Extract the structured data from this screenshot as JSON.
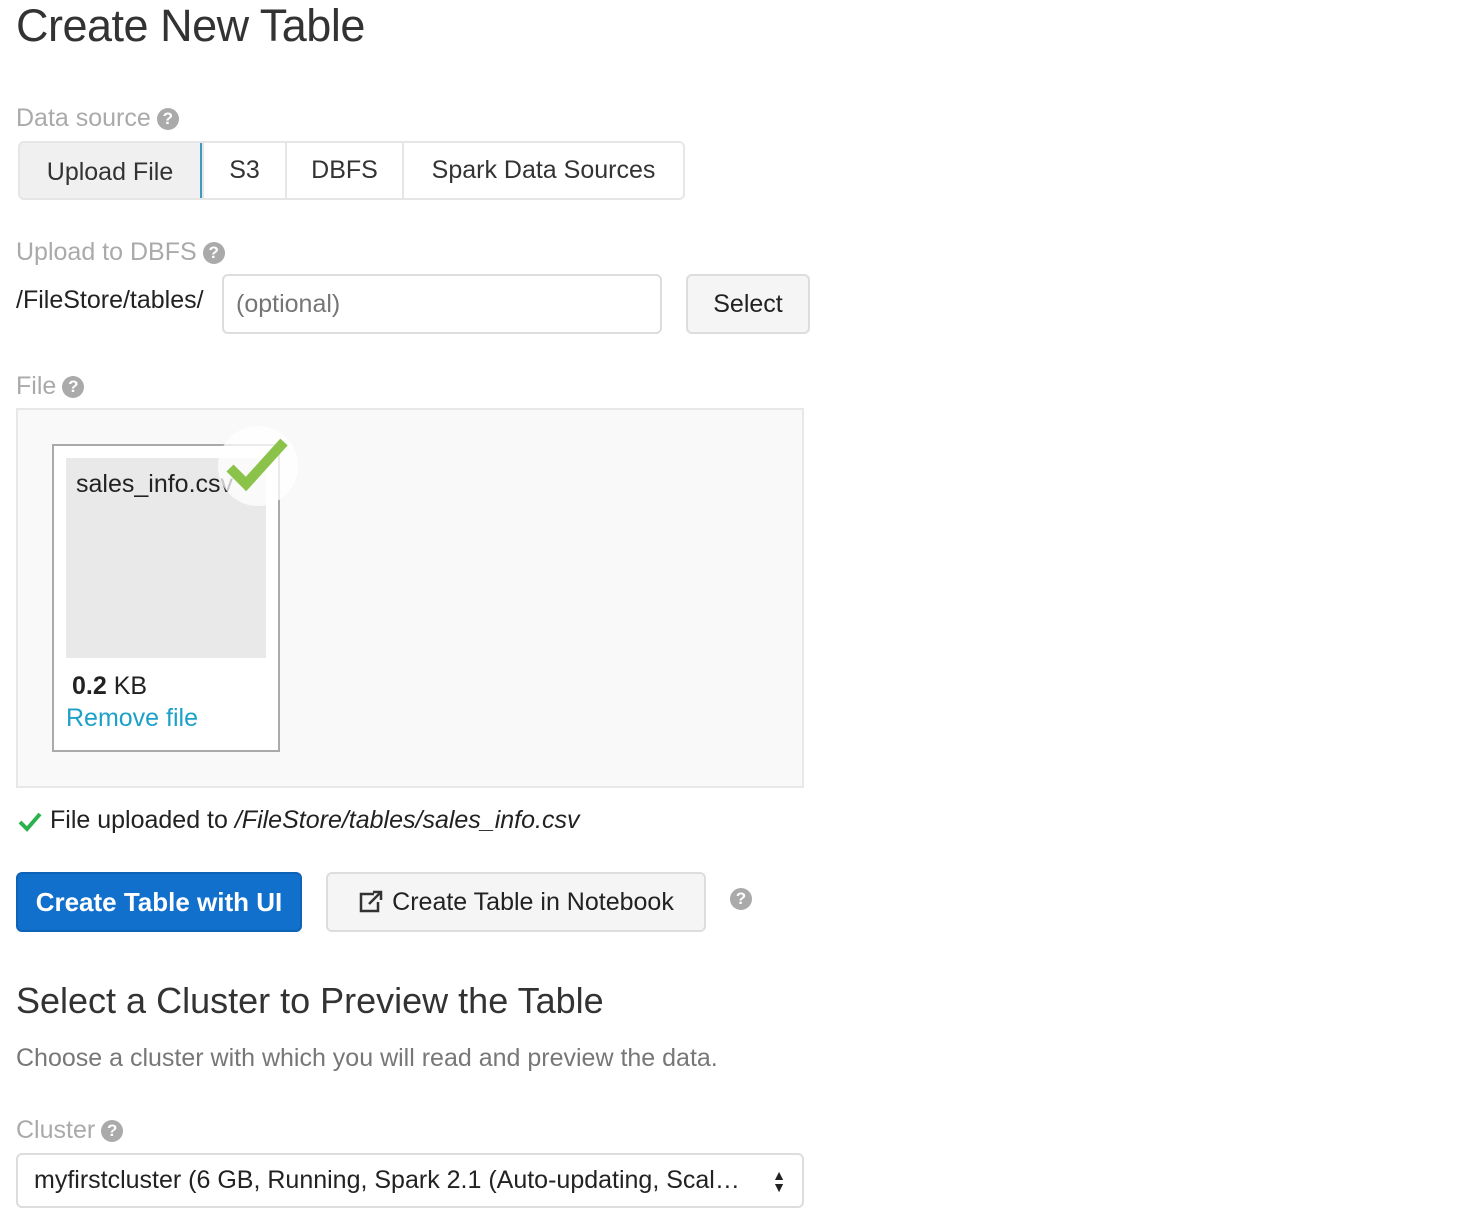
{
  "page_title": "Create New Table",
  "data_source": {
    "label": "Data source",
    "tabs": [
      "Upload File",
      "S3",
      "DBFS",
      "Spark Data Sources"
    ],
    "active_tab": "Upload File"
  },
  "upload_to_dbfs": {
    "label": "Upload to DBFS",
    "prefix": "/FileStore/tables/",
    "input_value": "",
    "input_placeholder": "(optional)",
    "select_label": "Select"
  },
  "file": {
    "label": "File",
    "name": "sales_info.csv",
    "size_value": "0.2",
    "size_unit": "KB",
    "remove_label": "Remove file"
  },
  "status": {
    "text": "File uploaded to ",
    "path": "/FileStore/tables/sales_info.csv"
  },
  "actions": {
    "create_ui": "Create Table with UI",
    "create_notebook": "Create Table in Notebook"
  },
  "cluster_section": {
    "heading": "Select a Cluster to Preview the Table",
    "description": "Choose a cluster with which you will read and preview the data.",
    "label": "Cluster",
    "selected": "myfirstcluster (6 GB, Running, Spark 2.1 (Auto-updating, Scal…"
  },
  "colors": {
    "primary": "#1170cc",
    "link": "#1ca1c8",
    "success": "#2bb24c",
    "check": "#8bc34a"
  }
}
